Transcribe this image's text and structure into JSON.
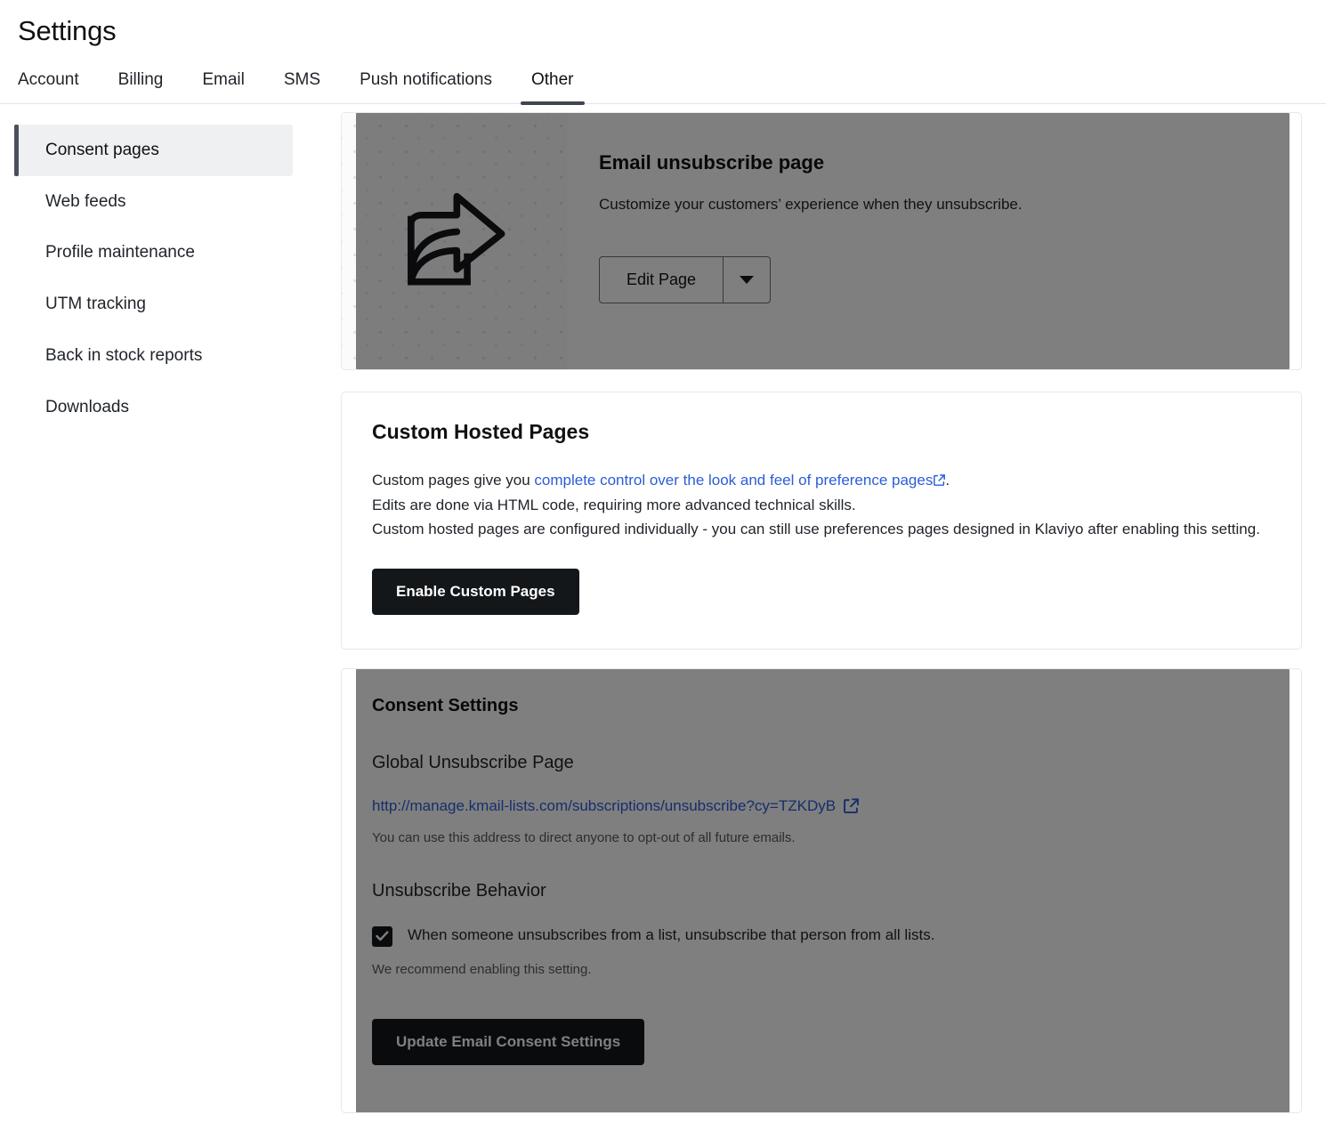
{
  "header": {
    "title": "Settings",
    "tabs": [
      {
        "label": "Account",
        "active": false
      },
      {
        "label": "Billing",
        "active": false
      },
      {
        "label": "Email",
        "active": false
      },
      {
        "label": "SMS",
        "active": false
      },
      {
        "label": "Push notifications",
        "active": false
      },
      {
        "label": "Other",
        "active": true
      }
    ]
  },
  "sidebar": {
    "items": [
      {
        "label": "Consent pages",
        "active": true
      },
      {
        "label": "Web feeds",
        "active": false
      },
      {
        "label": "Profile maintenance",
        "active": false
      },
      {
        "label": "UTM tracking",
        "active": false
      },
      {
        "label": "Back in stock reports",
        "active": false
      },
      {
        "label": "Downloads",
        "active": false
      }
    ]
  },
  "unsubscribe_card": {
    "title": "Email unsubscribe page",
    "subtitle": "Customize your customers’ experience when they unsubscribe.",
    "button_label": "Edit Page",
    "thumbnail_icon": "share-arrow-icon",
    "dimmed": true
  },
  "custom_hosted_pages": {
    "title": "Custom Hosted Pages",
    "paragraph_1_prefix": "Custom pages give you ",
    "paragraph_1_link": "complete control over the look and feel of preference pages",
    "paragraph_1_suffix": ".",
    "paragraph_2": "Edits are done via HTML code, requiring more advanced technical skills.",
    "paragraph_3": "Custom hosted pages are configured individually - you can still use preferences pages designed in Klaviyo after enabling this setting.",
    "button_label": "Enable Custom Pages"
  },
  "consent_settings": {
    "title": "Consent Settings",
    "global_unsubscribe_label": "Global Unsubscribe Page",
    "global_unsubscribe_url": "http://manage.kmail-lists.com/subscriptions/unsubscribe?cy=TZKDyB",
    "global_unsubscribe_hint": "You can use this address to direct anyone to opt-out of all future emails.",
    "unsubscribe_behavior_label": "Unsubscribe Behavior",
    "checkbox_label": "When someone unsubscribes from a list, unsubscribe that person from all lists.",
    "checkbox_checked": true,
    "checkbox_hint": "We recommend enabling this setting.",
    "button_label": "Update Email Consent Settings",
    "dimmed": true
  },
  "colors": {
    "link": "#2b5cd9",
    "button_dark": "#14171a",
    "active_sidebar_bg": "#eef0f2",
    "active_sidebar_accent": "#4a5058",
    "dim_overlay": "rgba(0,0,0,0.5)"
  }
}
